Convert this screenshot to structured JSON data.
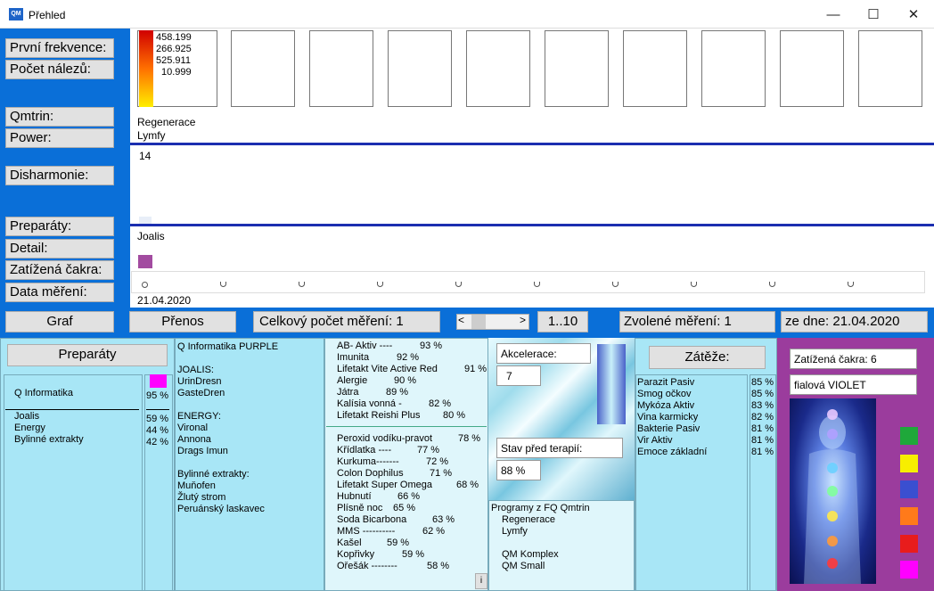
{
  "window": {
    "title": "Přehled",
    "icon": "QM",
    "min": "—",
    "max": "☐",
    "close": "✕"
  },
  "left_labels": [
    "První frekvence:",
    "Počet nálezů:",
    "Qmtrin:",
    "Power:",
    "Disharmonie:",
    "Preparáty:",
    "Detail:",
    "Zatížená čakra:",
    "Data měření:"
  ],
  "legend_values": [
    "458.199",
    "266.925",
    "525.911",
    "10.999"
  ],
  "regen": {
    "line1": "Regenerace",
    "line2": "Lymfy"
  },
  "disharmonie_value": "14",
  "preparat_name": "Joalis",
  "date_label": "21.04.2020",
  "toolbar": {
    "graf": "Graf",
    "prenos": "Přenos",
    "total": "Celkový počet měření: 1",
    "scroll_left": "<",
    "scroll_right": ">",
    "range": "1..10",
    "selected": "Zvolené měření: 1",
    "date": "ze dne:  21.04.2020"
  },
  "preparaty": {
    "button": "Preparáty",
    "header": "Q Informatika",
    "header_pct": "95 %",
    "items": [
      {
        "name": "Joalis",
        "pct": "59 %"
      },
      {
        "name": "Energy",
        "pct": "44 %"
      },
      {
        "name": "Bylinné extrakty",
        "pct": "42 %"
      }
    ]
  },
  "detail": {
    "lines": [
      "Q Informatika  PURPLE",
      "",
      "JOALIS:",
      "UrinDresn",
      "GasteDren",
      "",
      "ENERGY:",
      "Vironal",
      "Annona",
      "Drags Imun",
      "",
      "Bylinné extrakty:",
      "Muňofen",
      "Žlutý strom",
      "Peruánský laskavec"
    ]
  },
  "top_list": [
    {
      "name": "AB- Aktiv ----",
      "pct": "93 %"
    },
    {
      "name": "Imunita",
      "pct": "92 %"
    },
    {
      "name": "Lifetakt Vite Active Red",
      "pct": "91 %"
    },
    {
      "name": "Alergie",
      "pct": "90 %"
    },
    {
      "name": "Játra",
      "pct": "89 %"
    },
    {
      "name": "Kalísia vonná  -",
      "pct": "82 %"
    },
    {
      "name": "Lifetakt Reishi Plus",
      "pct": "80 %"
    }
  ],
  "bottom_list": [
    {
      "name": "Peroxid vodíku-pravot",
      "pct": "78 %"
    },
    {
      "name": "Křídlatka ----",
      "pct": "77 %"
    },
    {
      "name": "Kurkuma-------",
      "pct": "72 %"
    },
    {
      "name": "Colon Dophilus",
      "pct": "71 %"
    },
    {
      "name": "Lifetakt Super Omega",
      "pct": "68 %"
    },
    {
      "name": "Hubnutí",
      "pct": "66 %"
    },
    {
      "name": "Plísně noc",
      "pct": "65 %"
    },
    {
      "name": "Soda Bicarbona",
      "pct": "63 %"
    },
    {
      "name": "MMS ----------",
      "pct": "62 %"
    },
    {
      "name": "Kašel",
      "pct": "59 %"
    },
    {
      "name": "Kopřivky",
      "pct": "59 %"
    },
    {
      "name": "Ořešák --------",
      "pct": "58 %"
    }
  ],
  "info_button": "i",
  "akcelerace": {
    "label": "Akcelerace:",
    "value": "7",
    "stav_label": "Stav před terapií:",
    "stav_value": "88 %"
  },
  "programy": {
    "title": "Programy z FQ Qmtrin",
    "items": [
      "Regenerace",
      "Lymfy",
      "",
      "QM Komplex",
      "QM Small"
    ]
  },
  "zateze": {
    "button": "Zátěže:",
    "items": [
      {
        "name": "Parazit Pasiv",
        "pct": "85 %"
      },
      {
        "name": "Smog očkov",
        "pct": "85 %"
      },
      {
        "name": "Mykóza Aktiv",
        "pct": "83 %"
      },
      {
        "name": "Vina karmicky",
        "pct": "82 %"
      },
      {
        "name": "Bakterie Pasiv",
        "pct": "81 %"
      },
      {
        "name": "Vir Aktiv",
        "pct": "81 %"
      },
      {
        "name": "Emoce základní",
        "pct": "81 %"
      }
    ]
  },
  "cakra": {
    "label": "Zatížená čakra: 6",
    "color_name": "fialová  VIOLET",
    "chakra_colors": [
      "#1fa83a",
      "#f7ee00",
      "#3a4fd0",
      "#ff7a1a",
      "#e81c1c",
      "#ff00ff"
    ]
  }
}
